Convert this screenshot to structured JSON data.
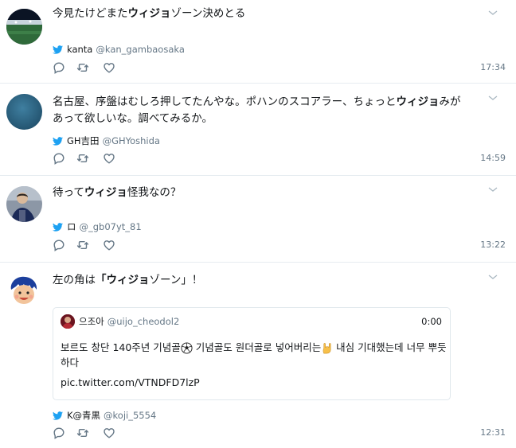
{
  "accent_color": "#1da1f2",
  "icon_color": "#657786",
  "tweets": [
    {
      "text_pre": "今見たけどまた",
      "keyword": "ウィジョ",
      "text_post": "ゾーン決めとる",
      "display_name": "kanta",
      "handle": "@kan_gambaosaka",
      "time": "17:34"
    },
    {
      "text_pre": "名古屋、序盤はむしろ押してたんやな。ポハンのスコアラー、ちょっと",
      "keyword": "ウィジョ",
      "text_post": "みがあって欲しいな。調べてみるか。",
      "display_name": "GH吉田",
      "handle": "@GHYoshida",
      "time": "14:59"
    },
    {
      "text_pre": "待って",
      "keyword": "ウィジョ",
      "text_post": "怪我なの？",
      "display_name": "ロ",
      "handle": "@_gb07yt_81",
      "time": "13:22"
    },
    {
      "text_pre": "左の角は",
      "keyword": "「ウィジョ",
      "text_post": "ゾーン」！",
      "display_name": "K@青黒",
      "handle": "@koji_5554",
      "time": "12:31",
      "quote": {
        "display_name": "으조아",
        "handle": "@uijo_cheodol2",
        "time": "0:00",
        "text_a": "보르도 창단 140주년 기념골",
        "text_b": " 기념골도 원더골로 넣어버리는",
        "text_c": " 내심 기대했는데 너무 뿌듯하다",
        "link": "pic.twitter.com/VTNDFD7lzP",
        "emoji_1": "soccer-ball",
        "emoji_2": "sign-of-horns"
      }
    }
  ]
}
